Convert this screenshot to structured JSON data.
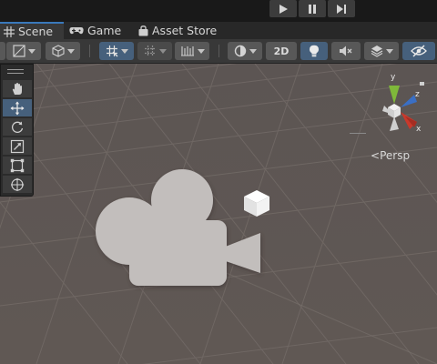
{
  "playmode": {
    "buttons": [
      {
        "name": "play-button",
        "icon": "play-icon"
      },
      {
        "name": "pause-button",
        "icon": "pause-icon"
      },
      {
        "name": "step-button",
        "icon": "step-forward-icon"
      }
    ]
  },
  "tabs": [
    {
      "label": "Scene",
      "icon": "grid-icon",
      "active": true
    },
    {
      "label": "Game",
      "icon": "gamepad-icon",
      "active": false
    },
    {
      "label": "Asset Store",
      "icon": "shopping-bag-icon",
      "active": false
    }
  ],
  "toolbar": {
    "mode_2d_label": "2D"
  },
  "scene": {
    "gizmo": {
      "axis_y": "y",
      "axis_z": "z",
      "axis_x": "x",
      "colors": {
        "x": "#c8392c",
        "y": "#7fb83a",
        "z": "#3a6fc4"
      }
    },
    "projection_label": "Persp"
  },
  "tools": [
    {
      "name": "hand-tool",
      "icon": "hand-icon",
      "selected": false
    },
    {
      "name": "move-tool",
      "icon": "move-arrows-icon",
      "selected": true
    },
    {
      "name": "rotate-tool",
      "icon": "rotate-icon",
      "selected": false
    },
    {
      "name": "scale-tool",
      "icon": "scale-icon",
      "selected": false
    },
    {
      "name": "rect-tool",
      "icon": "rect-transform-icon",
      "selected": false
    },
    {
      "name": "transform-tool",
      "icon": "transform-icon",
      "selected": false
    }
  ],
  "colors": {
    "accent": "#3a79bb",
    "selected_button": "#46607c",
    "scene_background": "#5e5652"
  }
}
